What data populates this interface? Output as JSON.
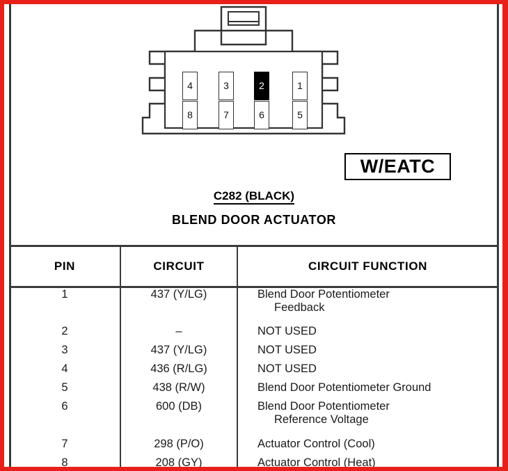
{
  "diagram": {
    "connector": {
      "label": "connector-body",
      "pins": [
        {
          "number": "4",
          "row": "top",
          "position": 1,
          "highlighted": false
        },
        {
          "number": "3",
          "row": "top",
          "position": 2,
          "highlighted": false
        },
        {
          "number": "2",
          "row": "top",
          "position": 3,
          "highlighted": true
        },
        {
          "number": "1",
          "row": "top",
          "position": 4,
          "highlighted": false
        },
        {
          "number": "8",
          "row": "bottom",
          "position": 1,
          "highlighted": false
        },
        {
          "number": "7",
          "row": "bottom",
          "position": 2,
          "highlighted": false
        },
        {
          "number": "6",
          "row": "bottom",
          "position": 3,
          "highlighted": false
        },
        {
          "number": "5",
          "row": "bottom",
          "position": 4,
          "highlighted": false
        }
      ]
    },
    "callout": "W/EATC",
    "connector_id": "C282 (BLACK)",
    "component_name": "BLEND DOOR ACTUATOR"
  },
  "table": {
    "headers": [
      "PIN",
      "CIRCUIT",
      "CIRCUIT FUNCTION"
    ],
    "rows": [
      {
        "pin": "1",
        "circuit": "437 (Y/LG)",
        "function_line1": "Blend Door Potentiometer",
        "function_line2": "Feedback"
      },
      {
        "pin": "2",
        "circuit": "–",
        "function_line1": "NOT USED",
        "function_line2": ""
      },
      {
        "pin": "3",
        "circuit": "437 (Y/LG)",
        "function_line1": "NOT USED",
        "function_line2": ""
      },
      {
        "pin": "4",
        "circuit": "436 (R/LG)",
        "function_line1": "NOT USED",
        "function_line2": ""
      },
      {
        "pin": "5",
        "circuit": "438 (R/W)",
        "function_line1": "Blend Door Potentiometer Ground",
        "function_line2": ""
      },
      {
        "pin": "6",
        "circuit": "600 (DB)",
        "function_line1": "Blend Door Potentiometer",
        "function_line2": "Reference Voltage"
      },
      {
        "pin": "7",
        "circuit": "298 (P/O)",
        "function_line1": "Actuator Control (Cool)",
        "function_line2": ""
      },
      {
        "pin": "8",
        "circuit": "208 (GY)",
        "function_line1": "Actuator Control (Heat)",
        "function_line2": ""
      }
    ]
  },
  "colors": {
    "page_border": "#e8201a",
    "line": "#3a3a3a",
    "ink": "#000000",
    "paper": "#ffffff",
    "pin_highlight": "#000000"
  }
}
